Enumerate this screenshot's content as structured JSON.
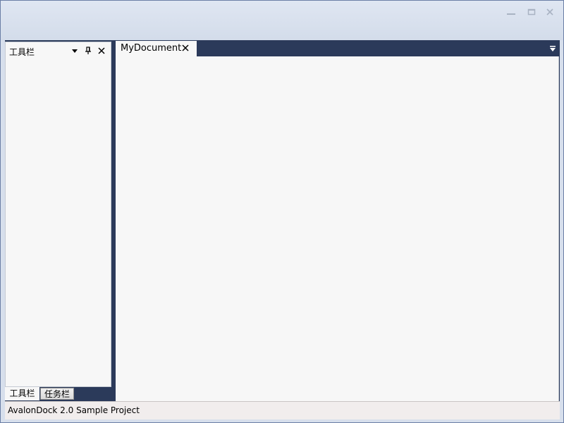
{
  "window": {
    "title": "",
    "controls": {
      "minimize_icon": "minimize-icon",
      "maximize_icon": "maximize-icon",
      "close_icon": "close-icon"
    }
  },
  "tool_panel": {
    "title": "工具栏",
    "icons": [
      "menu-dropdown-icon",
      "pin-icon",
      "close-icon"
    ],
    "tabs": [
      {
        "label": "工具栏",
        "active": true
      },
      {
        "label": "任务栏",
        "active": false
      }
    ]
  },
  "document": {
    "tabs": [
      {
        "label": "MyDocument",
        "active": true
      }
    ],
    "dropdown_icon": "document-list-dropdown-icon"
  },
  "statusbar": {
    "text": "AvalonDock 2.0 Sample Project"
  },
  "colors": {
    "titlebar": "#d7dfec",
    "dock_background": "#2b3a5a",
    "panel_background": "#f7f7f7",
    "statusbar": "#f1eded"
  }
}
